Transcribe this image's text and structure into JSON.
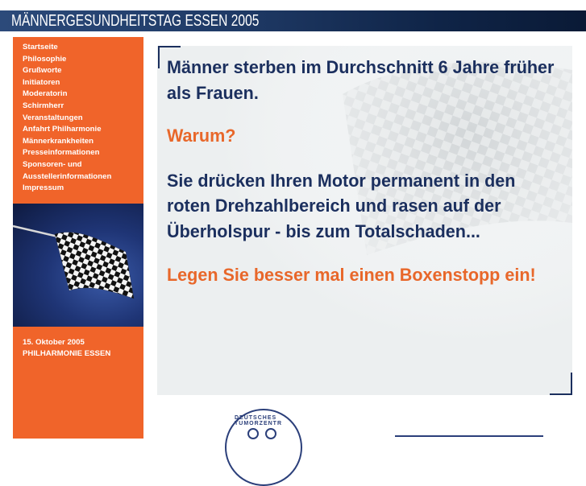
{
  "header": {
    "title": "MÄNNERGESUNDHEITSTAG ESSEN 2005"
  },
  "sidebar": {
    "nav": [
      "Startseite",
      "Philosophie",
      "Grußworte",
      "Initiatoren",
      "Moderatorin",
      "Schirmherr",
      "Veranstaltungen",
      "Anfahrt Philharmonie",
      "Männerkrankheiten",
      "Presseinformationen",
      "Sponsoren- und",
      "Ausstellerinformationen",
      "Impressum"
    ],
    "event_date": "15. Oktober 2005",
    "event_venue": "PHILHARMONIE ESSEN"
  },
  "content": {
    "para1": "Männer sterben im Durchschnitt 6 Jahre früher als Frauen.",
    "para2": "Warum?",
    "para3": "Sie drücken Ihren Motor permanent in den roten Drehzahlbereich und rasen auf der Überholspur - bis zum Totalschaden...",
    "para4": "Legen Sie besser mal einen Boxenstopp ein!"
  },
  "logo": {
    "ring_text": "DEUTSCHES TUMORZENTR"
  },
  "colors": {
    "header_blue": "#1f3a66",
    "sidebar_orange": "#f0642a",
    "text_blue": "#1b2f5e",
    "text_orange": "#e8672a",
    "content_bg": "#eceff0"
  }
}
